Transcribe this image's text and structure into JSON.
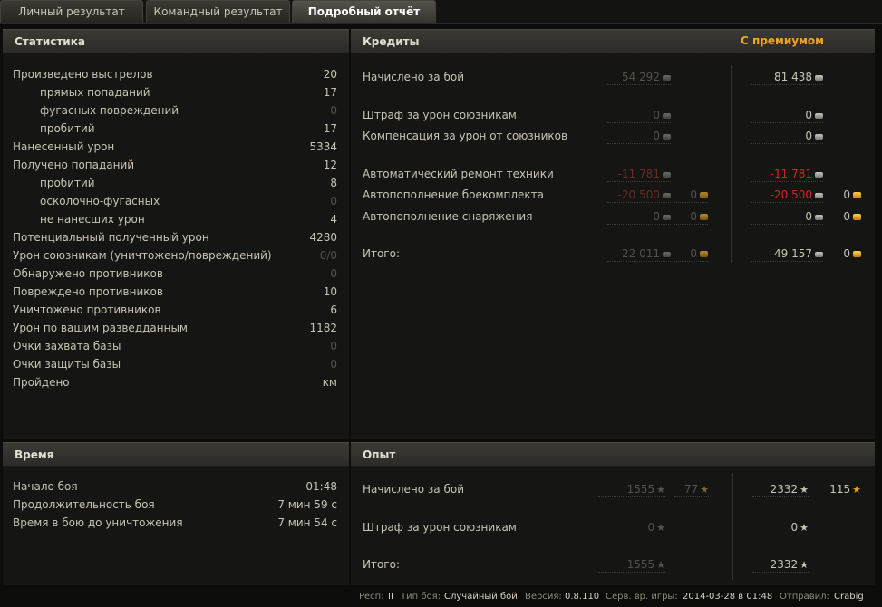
{
  "tabs": [
    {
      "label": "Личный результат"
    },
    {
      "label": "Командный результат"
    },
    {
      "label": "Подробный отчёт"
    }
  ],
  "stats": {
    "title": "Статистика",
    "rows": [
      {
        "label": "Произведено выстрелов",
        "value": "20"
      },
      {
        "label": "прямых попаданий",
        "value": "17"
      },
      {
        "label": "фугасных повреждений",
        "value": "0"
      },
      {
        "label": "пробитий",
        "value": "17"
      },
      {
        "label": "Нанесенный урон",
        "value": "5334"
      },
      {
        "label": "Получено попаданий",
        "value": "12"
      },
      {
        "label": "пробитий",
        "value": "8"
      },
      {
        "label": "осколочно-фугасных",
        "value": "0"
      },
      {
        "label": "не нанесших урон",
        "value": "4"
      },
      {
        "label": "Потенциальный полученный урон",
        "value": "4280"
      },
      {
        "label": "Урон союзникам (уничтожено/повреждений)",
        "value": "0/0"
      },
      {
        "label": "Обнаружено противников",
        "value": "0"
      },
      {
        "label": "Повреждено противников",
        "value": "10"
      },
      {
        "label": "Уничтожено противников",
        "value": "6"
      },
      {
        "label": "Урон по вашим разведданным",
        "value": "1182"
      },
      {
        "label": "Очки захвата базы",
        "value": "0"
      },
      {
        "label": "Очки защиты базы",
        "value": "0"
      },
      {
        "label": "Пройдено",
        "value": "км"
      }
    ]
  },
  "credits": {
    "title": "Кредиты",
    "premium_label": "С премиумом",
    "rows": [
      {
        "label": "Начислено за бой",
        "base": "54 292",
        "prem": "81 438"
      },
      {
        "label": "Штраф за урон союзникам",
        "base": "0",
        "prem": "0"
      },
      {
        "label": "Компенсация за урон от союзников",
        "base": "0",
        "prem": "0"
      },
      {
        "label": "Автоматический ремонт техники",
        "base": "-11 781",
        "prem": "-11 781"
      },
      {
        "label": "Автопополнение боекомплекта",
        "base": "-20 500",
        "base_gold": "0",
        "prem": "-20 500",
        "prem_gold": "0"
      },
      {
        "label": "Автопополнение снаряжения",
        "base": "0",
        "base_gold": "0",
        "prem": "0",
        "prem_gold": "0"
      },
      {
        "label": "Итого:",
        "base": "22 011",
        "base_gold": "0",
        "prem": "49 157",
        "prem_gold": "0"
      }
    ]
  },
  "time": {
    "title": "Время",
    "rows": [
      {
        "label": "Начало боя",
        "value": "01:48"
      },
      {
        "label": "Продолжительность боя",
        "value": "7 мин 59 с"
      },
      {
        "label": "Время в бою до уничтожения",
        "value": "7 мин 54 с"
      }
    ]
  },
  "xp": {
    "title": "Опыт",
    "rows": [
      {
        "label": "Начислено за бой",
        "base": "1555",
        "base_free": "77",
        "prem": "2332",
        "prem_free": "115"
      },
      {
        "label": "Штраф за урон союзникам",
        "base": "0",
        "prem": "0"
      },
      {
        "label": "Итого:",
        "base": "1555",
        "prem": "2332"
      }
    ]
  },
  "footer": {
    "resp_label": "Респ:",
    "resp_value": "II",
    "battle_type_label": "Тип боя:",
    "battle_type_value": "Случайный бой",
    "version_label": "Версия:",
    "version_value": "0.8.110",
    "server_time_label": "Серв. вр. игры:",
    "server_time_value": "2014-03-28 в 01:48",
    "sender_label": "Отправил:",
    "sender_value": "Crabig"
  },
  "colors": {
    "premium": "#f2a427",
    "negative": "#d4271c",
    "gold": "#e2a322"
  }
}
